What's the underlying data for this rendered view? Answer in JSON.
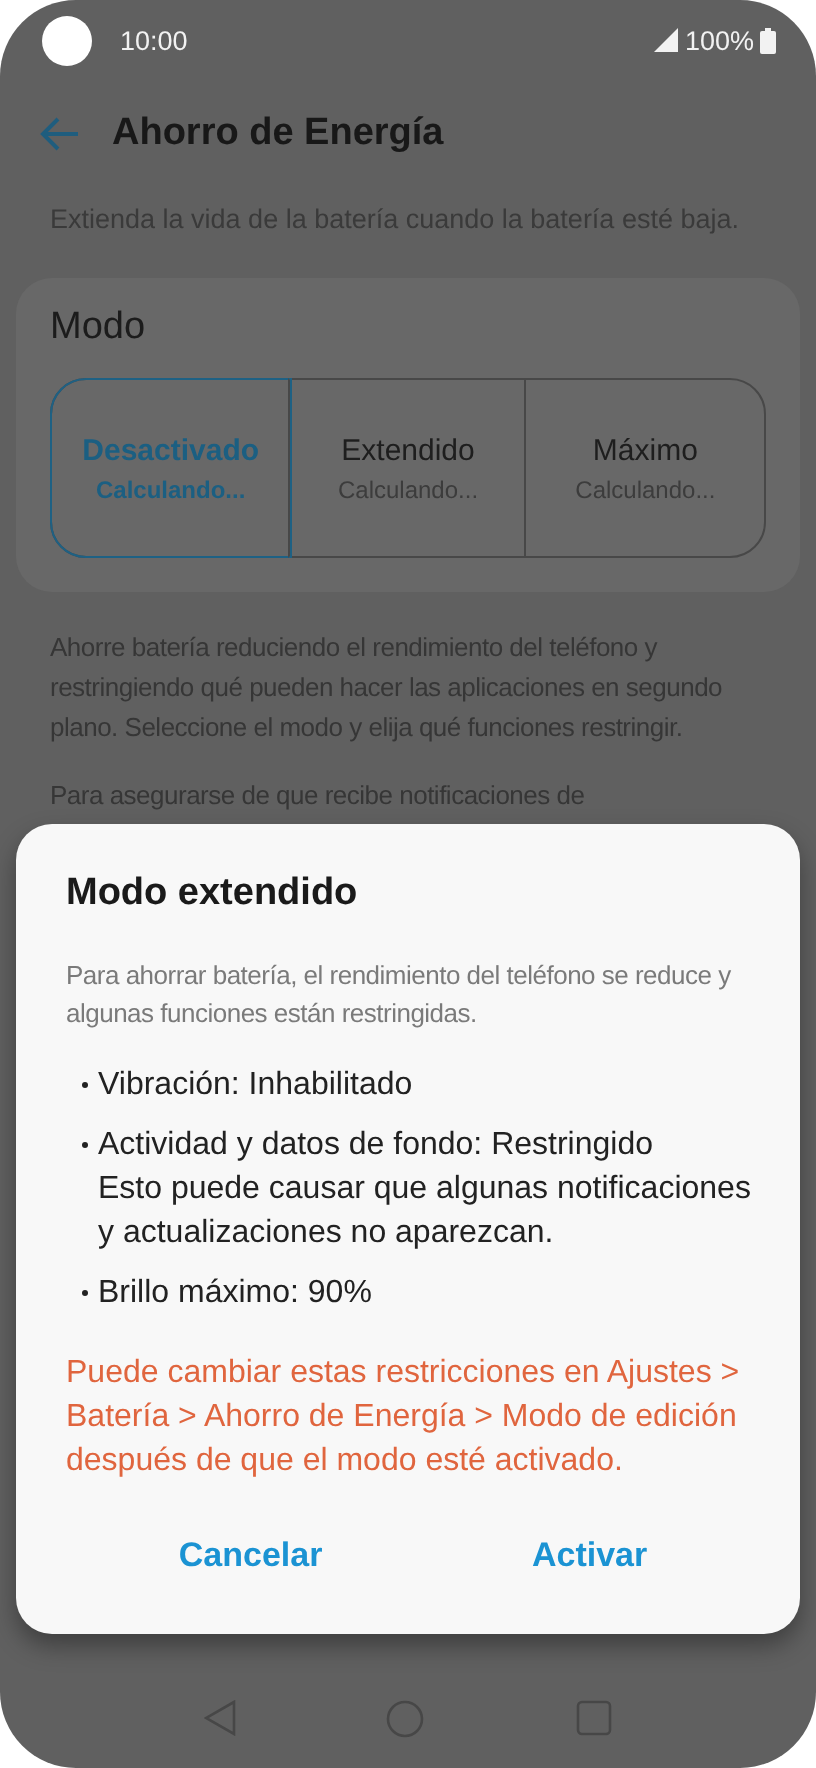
{
  "status_bar": {
    "time": "10:00",
    "battery": "100%"
  },
  "header": {
    "title": "Ahorro de Energía"
  },
  "description": "Extienda la vida de la batería cuando la batería esté baja.",
  "mode_card": {
    "title": "Modo",
    "options": [
      {
        "label": "Desactivado",
        "status": "Calculando...",
        "selected": true
      },
      {
        "label": "Extendido",
        "status": "Calculando...",
        "selected": false
      },
      {
        "label": "Máximo",
        "status": "Calculando...",
        "selected": false
      }
    ]
  },
  "paragraphs": [
    "Ahorre batería reduciendo el rendimiento del teléfono y restringiendo qué pueden hacer las aplicaciones en segundo plano. Seleccione el modo y elija qué funciones restringir.",
    "Para asegurarse de que recibe notificaciones de"
  ],
  "dialog": {
    "title": "Modo extendido",
    "description": "Para ahorrar batería, el rendimiento del teléfono se reduce y algunas funciones están restringidas.",
    "bullets": [
      {
        "text": "Vibración: Inhabilitado"
      },
      {
        "text": "Actividad y datos de fondo: Restringido",
        "note": "Esto puede causar que algunas notificaciones y actualizaciones no aparezcan."
      },
      {
        "text": "Brillo máximo: 90%"
      }
    ],
    "warning": "Puede cambiar estas restricciones en Ajustes > Batería > Ahorro de Energía > Modo de edición después de que el modo esté activado.",
    "buttons": [
      "Cancelar",
      "Activar"
    ]
  }
}
